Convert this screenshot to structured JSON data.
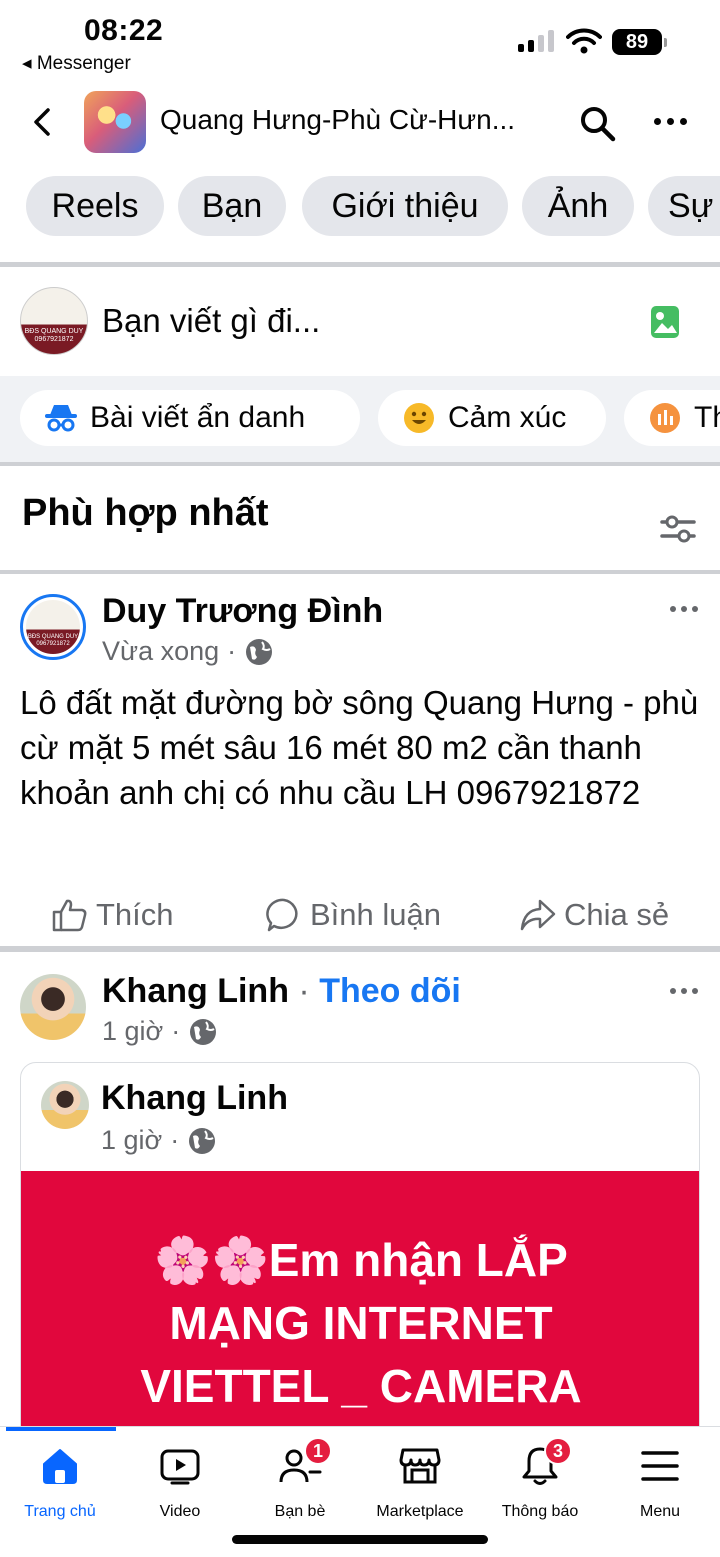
{
  "status": {
    "time": "08:22",
    "back_app": "◂ Messenger",
    "battery": "89"
  },
  "header": {
    "title": "Quang Hưng-Phù Cừ-Hưn..."
  },
  "tabs": [
    "Reels",
    "Bạn",
    "Giới thiệu",
    "Ảnh",
    "Sự"
  ],
  "composer": {
    "placeholder": "Bạn viết gì đi...",
    "avatar_text": "BĐS QUANG DUY 0967921872",
    "actions": [
      "Bài viết ẩn danh",
      "Cảm xúc",
      "Th"
    ]
  },
  "feed": {
    "title": "Phù hợp nhất"
  },
  "posts": [
    {
      "author": "Duy Trương Đình",
      "time": "Vừa xong",
      "avatar_text": "BĐS QUANG DUY 0967921872",
      "text": "Lô đất mặt đường bờ sông Quang Hưng - phù cừ mặt 5 mét sâu 16 mét 80 m2 cần thanh khoản anh chị có nhu cầu LH 0967921872",
      "actions": {
        "like": "Thích",
        "comment": "Bình luận",
        "share": "Chia sẻ"
      }
    },
    {
      "author": "Khang Linh",
      "separator": "·",
      "follow": "Theo dõi",
      "time": "1 giờ",
      "shared": {
        "author": "Khang Linh",
        "time": "1 giờ",
        "banner_lines": [
          "🌸🌸Em nhận LẮP",
          "MẠNG INTERNET",
          "VIETTEL _ CAMERA"
        ]
      }
    }
  ],
  "nav": [
    {
      "label": "Trang chủ",
      "icon": "home-icon",
      "badge": ""
    },
    {
      "label": "Video",
      "icon": "video-icon",
      "badge": ""
    },
    {
      "label": "Bạn bè",
      "icon": "friends-icon",
      "badge": "1"
    },
    {
      "label": "Marketplace",
      "icon": "marketplace-icon",
      "badge": ""
    },
    {
      "label": "Thông báo",
      "icon": "bell-icon",
      "badge": "3"
    },
    {
      "label": "Menu",
      "icon": "menu-icon",
      "badge": ""
    }
  ],
  "colors": {
    "accent": "#0866ff",
    "link": "#1877f2",
    "banner": "#e1073d",
    "badge": "#e41e3f",
    "chip": "#e4e6eb"
  }
}
